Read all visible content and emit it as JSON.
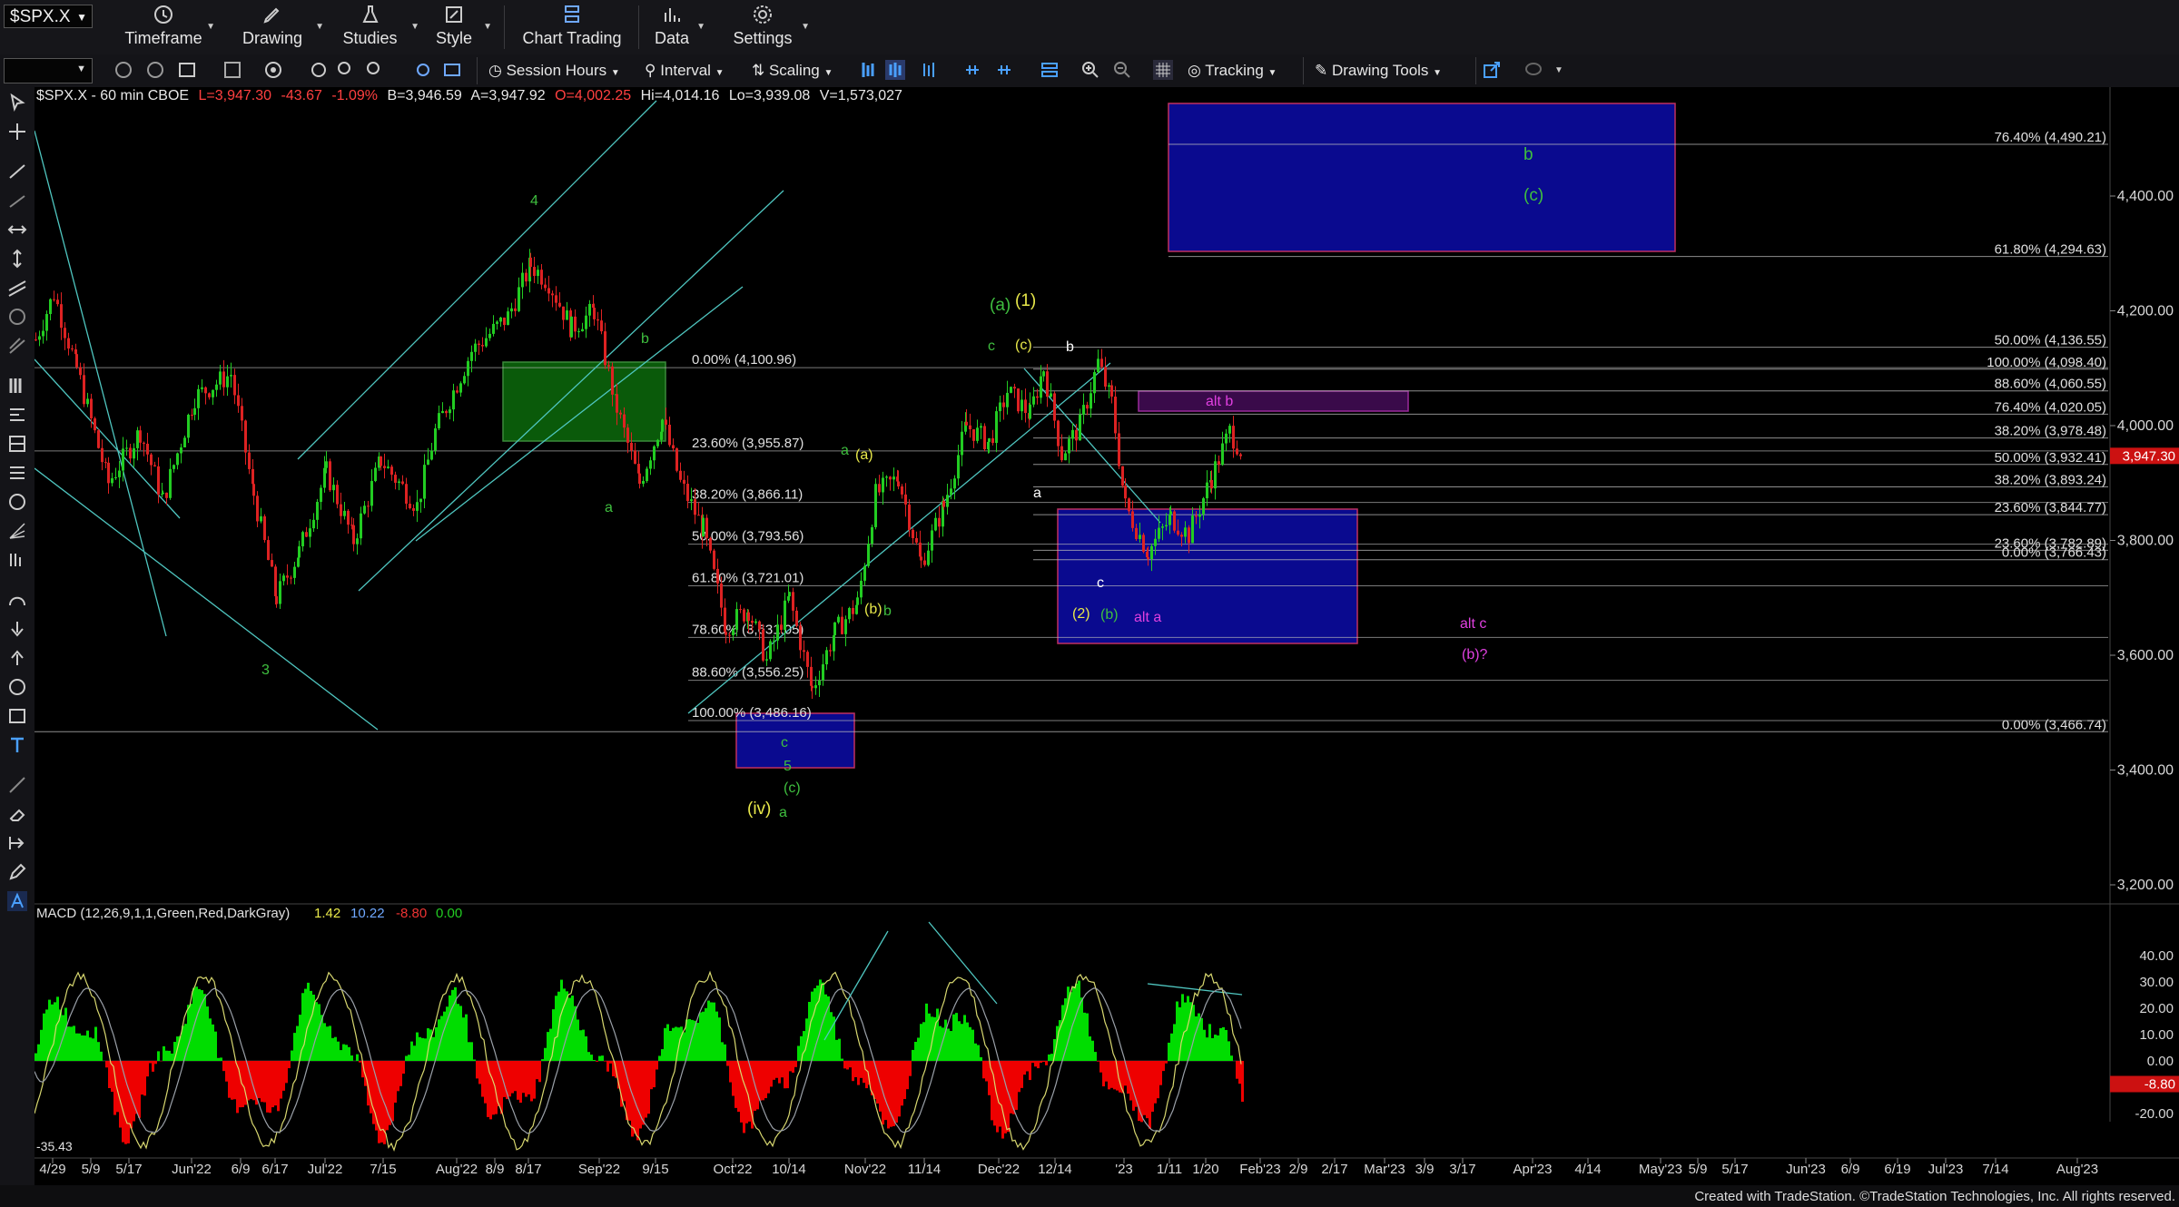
{
  "symbol_input": "$SPX.X",
  "toolbar": {
    "timeframe": "Timeframe",
    "drawing": "Drawing",
    "studies": "Studies",
    "style": "Style",
    "chart_trading": "Chart Trading",
    "data": "Data",
    "settings": "Settings"
  },
  "toolbar2": {
    "session_hours": "Session Hours",
    "interval": "Interval",
    "scaling": "Scaling",
    "tracking": "Tracking",
    "drawing_tools": "Drawing Tools"
  },
  "header": {
    "symbol_info": "$SPX.X - 60 min  CBOE",
    "last": "L=3,947.30",
    "change": "-43.67",
    "pct": "-1.09%",
    "bid": "B=3,946.59",
    "ask": "A=3,947.92",
    "open": "O=4,002.25",
    "high": "Hi=4,014.16",
    "low": "Lo=3,939.08",
    "volume": "V=1,573,027"
  },
  "price_axis": [
    "4,400.00",
    "4,200.00",
    "4,000.00",
    "3,800.00",
    "3,600.00",
    "3,400.00",
    "3,200.00"
  ],
  "last_price_tag": "3,947.30",
  "fib_right": [
    {
      "text": "76.40% (4,490.21)",
      "price": 4490.21
    },
    {
      "text": "61.80% (4,294.63)",
      "price": 4294.63
    },
    {
      "text": "50.00% (4,136.55)",
      "price": 4136.55
    },
    {
      "text": "100.00% (4,098.40)",
      "price": 4098.4
    },
    {
      "text": "88.60% (4,060.55)",
      "price": 4060.55
    },
    {
      "text": "76.40% (4,020.05)",
      "price": 4020.05
    },
    {
      "text": "38.20% (3,978.48)",
      "price": 3978.48
    },
    {
      "text": "50.00% (3,932.41)",
      "price": 3932.41
    },
    {
      "text": "38.20% (3,893.24)",
      "price": 3893.24
    },
    {
      "text": "23.60% (3,844.77)",
      "price": 3844.77
    },
    {
      "text": "23.60% (3,782.89)",
      "price": 3782.89
    },
    {
      "text": "0.00% (3,766.43)",
      "price": 3766.43
    },
    {
      "text": "0.00% (3,466.74)",
      "price": 3466.74
    }
  ],
  "fib_left": [
    {
      "text": "0.00% (4,100.96)",
      "price": 4100.96
    },
    {
      "text": "23.60% (3,955.87)",
      "price": 3955.87
    },
    {
      "text": "38.20% (3,866.11)",
      "price": 3866.11
    },
    {
      "text": "50.00% (3,793.56)",
      "price": 3793.56
    },
    {
      "text": "61.80% (3,721.01)",
      "price": 3721.01
    },
    {
      "text": "78.60% (3,631.05)",
      "price": 3631.05
    },
    {
      "text": "88.60% (3,556.25)",
      "price": 3556.25
    },
    {
      "text": "100.00% (3,486.16)",
      "price": 3486.16
    }
  ],
  "wave_labels": [
    {
      "text": "4",
      "color": "#3fbf3f"
    },
    {
      "text": "3",
      "color": "#3fbf3f"
    },
    {
      "text": "b",
      "color": "#3fbf3f"
    },
    {
      "text": "a",
      "color": "#3fbf3f"
    },
    {
      "text": "(a)",
      "color": "#3fbf3f"
    },
    {
      "text": "(1)",
      "color": "#e8e84a"
    },
    {
      "text": "c",
      "color": "#3fbf3f"
    },
    {
      "text": "(c)",
      "color": "#e8e84a"
    },
    {
      "text": "b",
      "color": "#ffffff"
    },
    {
      "text": "a",
      "color": "#3fbf3f"
    },
    {
      "text": "(a)",
      "color": "#e8e84a"
    },
    {
      "text": "(b)",
      "color": "#e8e84a"
    },
    {
      "text": "b",
      "color": "#3fbf3f"
    },
    {
      "text": "a",
      "color": "#ffffff"
    },
    {
      "text": "c",
      "color": "#ffffff"
    },
    {
      "text": "(2)",
      "color": "#e8e84a"
    },
    {
      "text": "(b)",
      "color": "#3fbf3f"
    },
    {
      "text": "alt a",
      "color": "#e040e0"
    },
    {
      "text": "alt b",
      "color": "#e040e0"
    },
    {
      "text": "alt c",
      "color": "#e040e0"
    },
    {
      "text": "(b)?",
      "color": "#e040e0"
    },
    {
      "text": "c",
      "color": "#3fbf3f"
    },
    {
      "text": "5",
      "color": "#3fbf3f"
    },
    {
      "text": "(c)",
      "color": "#3fbf3f"
    },
    {
      "text": "(iv)",
      "color": "#e8e84a"
    },
    {
      "text": "a",
      "color": "#3fbf3f"
    },
    {
      "text": "b",
      "color": "#3fbf3f"
    },
    {
      "text": "(c)",
      "color": "#3fbf3f"
    }
  ],
  "macd": {
    "label": "MACD (12,26,9,1,1,Green,Red,DarkGray)",
    "v1": "1.42",
    "v2": "10.22",
    "v3": "-8.80",
    "v4": "0.00",
    "axis": [
      "40.00",
      "30.00",
      "20.00",
      "10.00",
      "0.00",
      "-20.00"
    ],
    "tag": "-8.80",
    "low_label": "-35.43",
    "colors": {
      "up": "#00dd00",
      "down": "#ee0000",
      "line": "#d8d870",
      "signal": "#9aa0a8"
    }
  },
  "time_axis": [
    "4/29",
    "5/9",
    "5/17",
    "Jun'22",
    "6/9",
    "6/17",
    "Jul'22",
    "7/15",
    "Aug'22",
    "8/9",
    "8/17",
    "Sep'22",
    "9/15",
    "Oct'22",
    "10/14",
    "Nov'22",
    "11/14",
    "Dec'22",
    "12/14",
    "'23",
    "1/11",
    "1/20",
    "Feb'23",
    "2/9",
    "2/17",
    "Mar'23",
    "3/9",
    "3/17",
    "Apr'23",
    "4/14",
    "May'23",
    "5/9",
    "5/17",
    "Jun'23",
    "6/9",
    "6/19",
    "Jul'23",
    "7/14",
    "Aug'23"
  ],
  "credit": "Created with TradeStation. ©TradeStation Technologies, Inc. All rights reserved.",
  "colors": {
    "bull": "#22cc22",
    "bear": "#dd2222",
    "trendline": "#4fc6c0",
    "fib": "#bdbdbd",
    "box_blue": "#0a0a8f",
    "box_green": "#0a5a0a",
    "box_purple": "#3a0a4a"
  }
}
